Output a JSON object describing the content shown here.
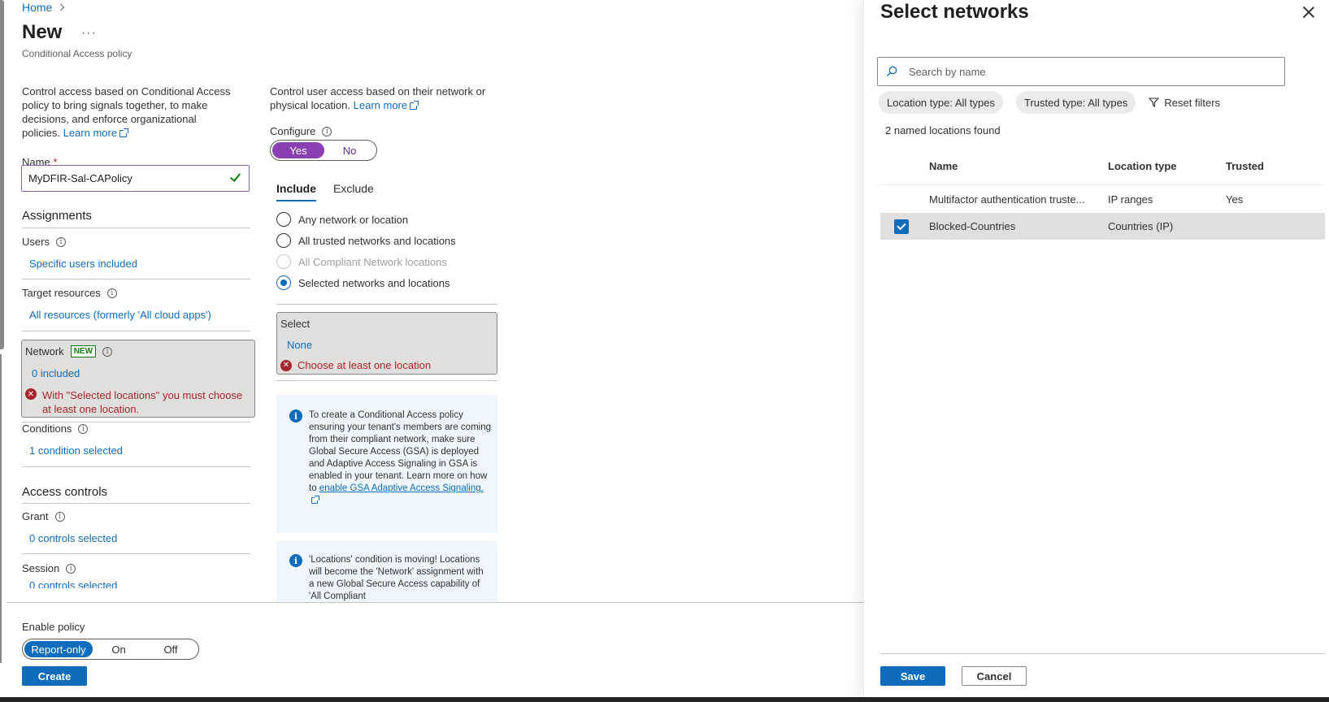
{
  "breadcrumb": {
    "home": "Home"
  },
  "page": {
    "title": "New",
    "more": "···",
    "subtitle": "Conditional Access policy"
  },
  "intro": {
    "text": "Control access based on Conditional Access policy to bring signals together, to make decisions, and enforce organizational policies.",
    "learn_more": "Learn more"
  },
  "name_field": {
    "label": "Name",
    "required_mark": "*",
    "value": "MyDFIR-Sal-CAPolicy"
  },
  "assignments": {
    "heading": "Assignments",
    "users": {
      "label": "Users",
      "value": "Specific users included"
    },
    "target_resources": {
      "label": "Target resources",
      "value": "All resources (formerly 'All cloud apps')"
    },
    "network": {
      "label": "Network",
      "badge": "NEW",
      "value": "0 included",
      "error": "With \"Selected locations\" you must choose at least one location."
    },
    "conditions": {
      "label": "Conditions",
      "value": "1 condition selected"
    }
  },
  "access_controls": {
    "heading": "Access controls",
    "grant": {
      "label": "Grant",
      "value": "0 controls selected"
    },
    "session": {
      "label": "Session",
      "value": "0 controls selected"
    }
  },
  "network_config": {
    "description": "Control user access based on their network or physical location.",
    "learn_more": "Learn more",
    "configure_label": "Configure",
    "configure_options": [
      "Yes",
      "No"
    ],
    "configure_selected": "Yes",
    "tabs": [
      "Include",
      "Exclude"
    ],
    "active_tab": "Include",
    "radio_options": [
      {
        "label": "Any network or location",
        "state": "unchecked"
      },
      {
        "label": "All trusted networks and locations",
        "state": "unchecked"
      },
      {
        "label": "All Compliant Network locations",
        "state": "disabled"
      },
      {
        "label": "Selected networks and locations",
        "state": "checked"
      }
    ],
    "select": {
      "label": "Select",
      "value": "None",
      "error": "Choose at least one location"
    },
    "info1": {
      "text": "To create a Conditional Access policy ensuring your tenant's members are coming from their compliant network, make sure Global Secure Access (GSA) is deployed and Adaptive Access Signaling in GSA is enabled in your tenant. Learn more on how to",
      "link": "enable GSA Adaptive Access Signaling."
    },
    "info2": {
      "text": "'Locations' condition is moving! Locations will become the 'Network' assignment with a new Global Secure Access capability of 'All Compliant"
    }
  },
  "enable_policy": {
    "label": "Enable policy",
    "options": [
      "Report-only",
      "On",
      "Off"
    ],
    "selected": "Report-only",
    "create_button": "Create"
  },
  "panel": {
    "title": "Select networks",
    "search_placeholder": "Search by name",
    "filters": [
      "Location type: All types",
      "Trusted type: All types"
    ],
    "reset_filters": "Reset filters",
    "result_count": "2 named locations found",
    "columns": [
      "Name",
      "Location type",
      "Trusted"
    ],
    "rows": [
      {
        "name": "Multifactor authentication truste...",
        "location_type": "IP ranges",
        "trusted": "Yes",
        "selected": false
      },
      {
        "name": "Blocked-Countries",
        "location_type": "Countries (IP)",
        "trusted": "",
        "selected": true
      }
    ],
    "save_button": "Save",
    "cancel_button": "Cancel"
  },
  "colors": {
    "accent": "#0f6cbd",
    "purple_toggle": "#8a3fb3",
    "error": "#a4262c",
    "success": "#107c10"
  }
}
